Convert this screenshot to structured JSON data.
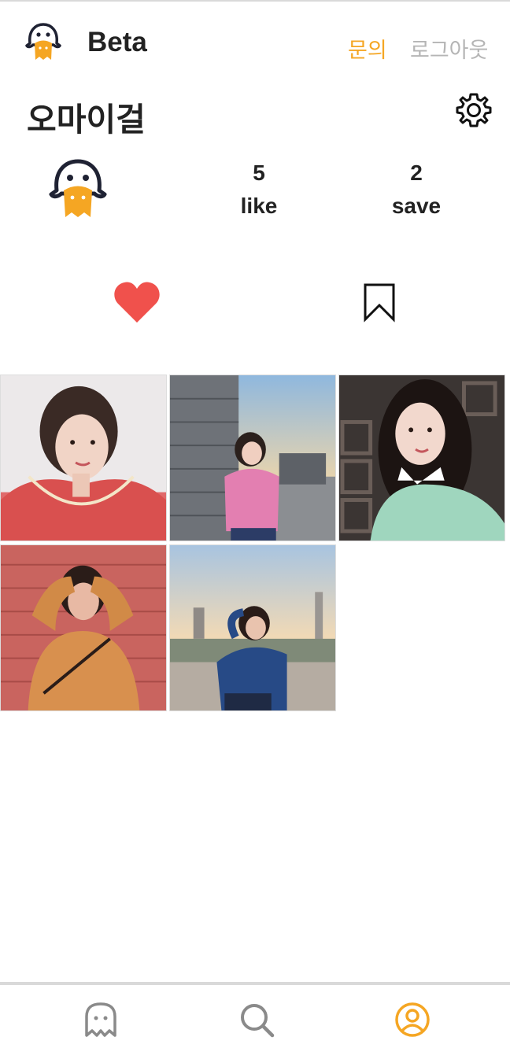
{
  "colors": {
    "accent": "#f5a623",
    "muted": "#b5b5b5",
    "heart": "#f0514c",
    "text": "#222222"
  },
  "header": {
    "logo_icon": "duck-logo-icon",
    "brand": "Beta",
    "inquiry_label": "문의",
    "logout_label": "로그아웃"
  },
  "profile": {
    "username": "오마이걸",
    "settings_icon": "gear-icon",
    "avatar_icon": "duck-avatar-icon",
    "stats": {
      "like": {
        "count": "5",
        "label": "like"
      },
      "save": {
        "count": "2",
        "label": "save"
      }
    }
  },
  "tabs": [
    {
      "icon": "heart-icon",
      "active": true
    },
    {
      "icon": "bookmark-icon",
      "active": false
    }
  ],
  "photos": [
    {
      "desc": "portrait-pink-dress"
    },
    {
      "desc": "rooftop-pink-sweater"
    },
    {
      "desc": "mint-sweater-portrait"
    },
    {
      "desc": "brick-wall-orange-sweater"
    },
    {
      "desc": "sunset-blue-sweater"
    }
  ],
  "bottom_nav": [
    {
      "icon": "ghost-home-icon",
      "active": false
    },
    {
      "icon": "search-icon",
      "active": false
    },
    {
      "icon": "profile-icon",
      "active": true
    }
  ]
}
